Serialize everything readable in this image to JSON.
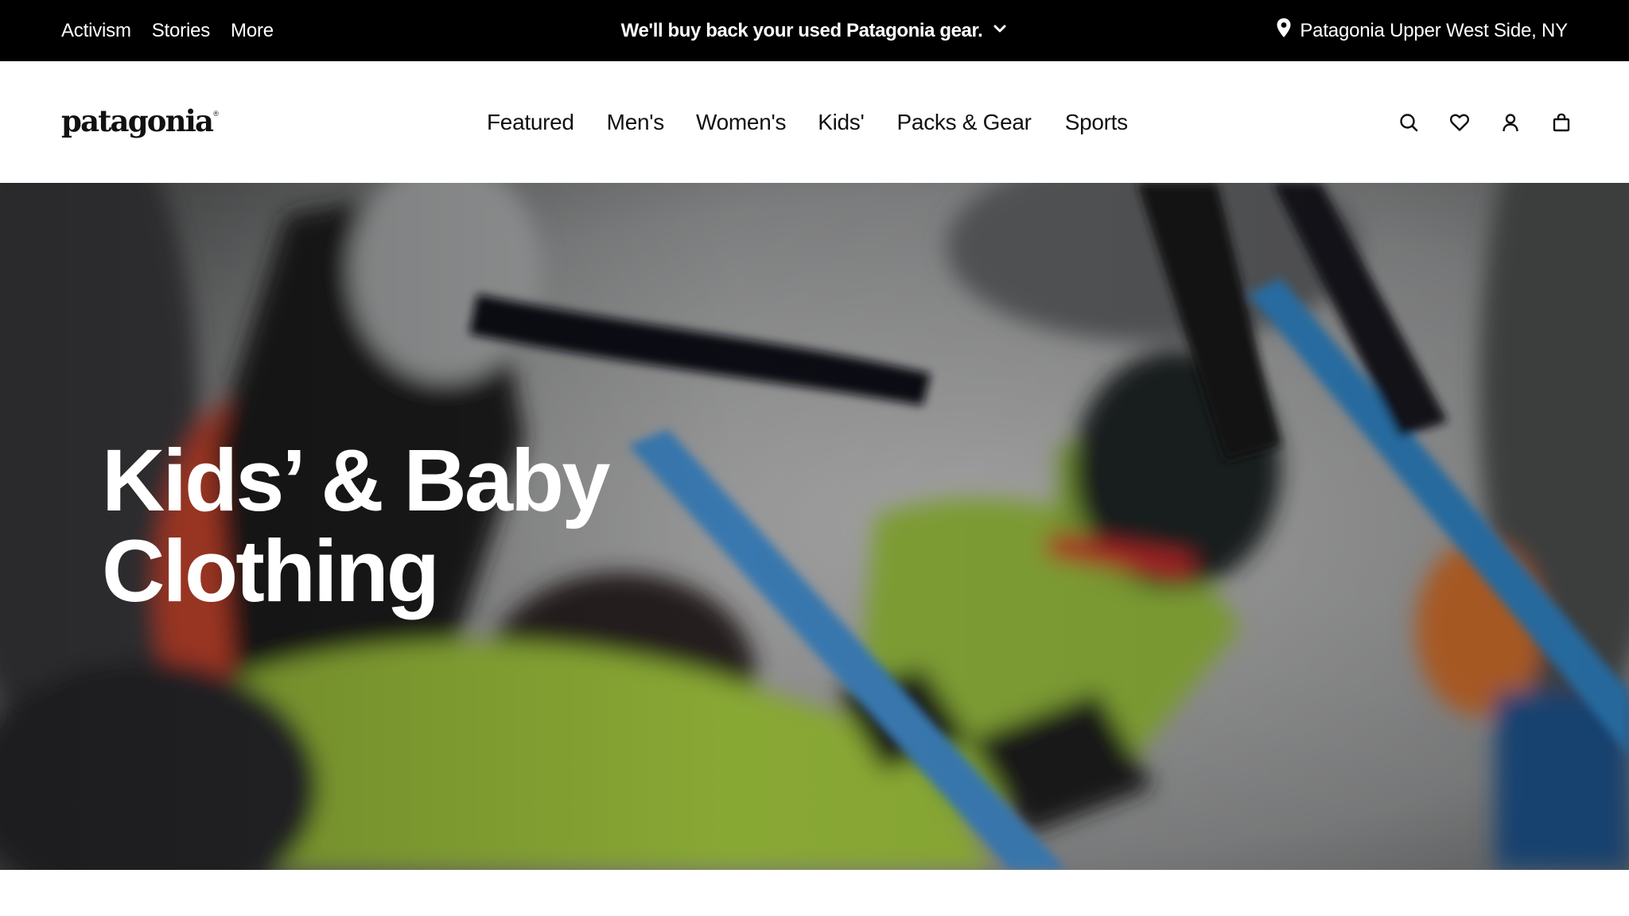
{
  "utility_bar": {
    "links": [
      "Activism",
      "Stories",
      "More"
    ],
    "promo": "We'll buy back your used Patagonia gear.",
    "promo_icon": "chevron-down-icon",
    "store": "Patagonia Upper West Side, NY",
    "store_icon": "location-pin-icon"
  },
  "header": {
    "logo": "patagonia",
    "logo_mark": "®",
    "nav": [
      "Featured",
      "Men's",
      "Women's",
      "Kids'",
      "Packs & Gear",
      "Sports"
    ],
    "icons": [
      "search-icon",
      "heart-icon",
      "account-icon",
      "bag-icon"
    ]
  },
  "hero": {
    "title_line1": "Kids’ & Baby",
    "title_line2": "Clothing",
    "image": "Child in green ski jacket and orange helmet holding blue ski poles in snow"
  },
  "colors": {
    "utility_bg": "#000000",
    "header_bg": "#ffffff",
    "text_dark": "#111111",
    "hero_text": "#ffffff"
  }
}
